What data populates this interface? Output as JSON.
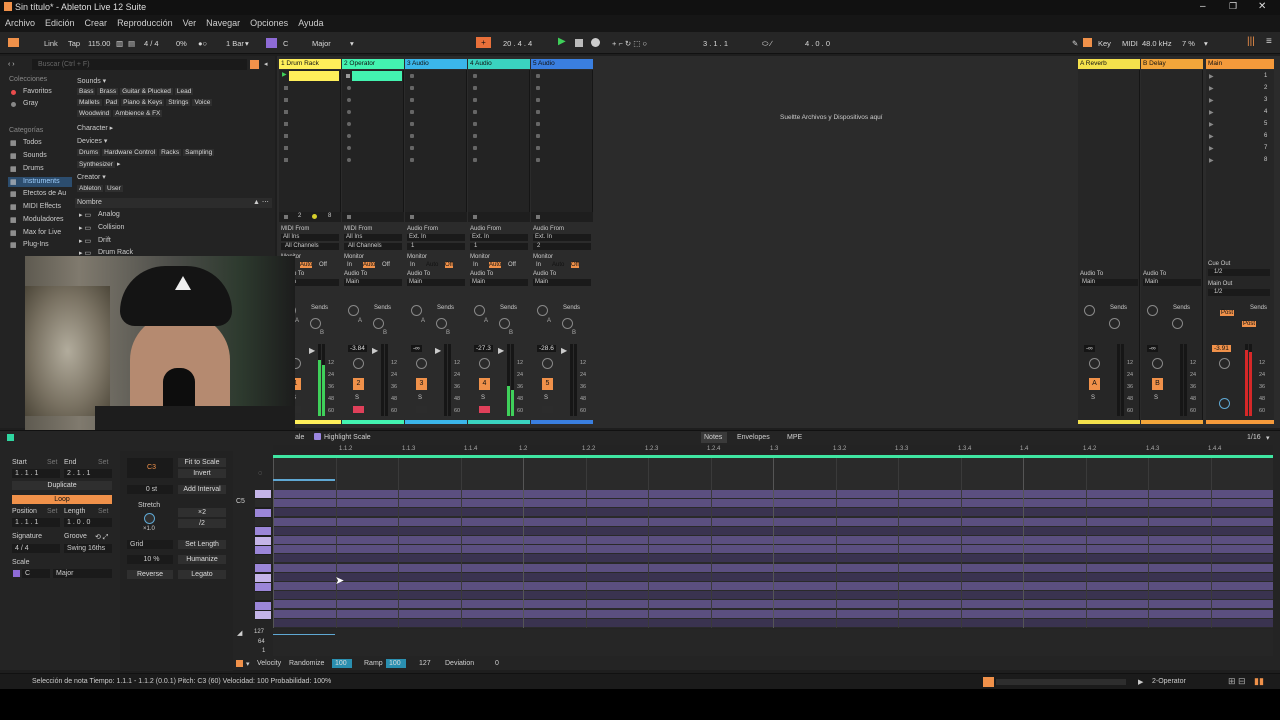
{
  "window": {
    "title": "Sin título* - Ableton Live 12 Suite"
  },
  "menu": [
    "Archivo",
    "Edición",
    "Crear",
    "Reproducción",
    "Ver",
    "Navegar",
    "Opciones",
    "Ayuda"
  ],
  "control_bar": {
    "link": "Link",
    "tap": "Tap",
    "tempo": "115.00",
    "signature": "4 / 4",
    "swing": "0%",
    "quantize": "1 Bar",
    "key": "C",
    "scale": "Major",
    "position": "20 .  4 .  4",
    "loop_start": "3 .  1 .  1",
    "loop_length": "4 .  0 .  0",
    "key_label": "Key",
    "midi_label": "MIDI",
    "sample_rate": "48.0 kHz",
    "cpu": "7 %"
  },
  "browser": {
    "search_placeholder": "Buscar (Ctrl + F)",
    "collections_header": "Colecciones",
    "collections": [
      "Favoritos",
      "Gray"
    ],
    "categories_header": "Categorías",
    "categories": [
      "Todos",
      "Sounds",
      "Drums",
      "Instruments",
      "Efectos de Au",
      "MIDI Effects",
      "Moduladores",
      "Max for Live",
      "Plug-Ins"
    ],
    "sounds_label": "Sounds ▾",
    "sounds_tags_1": [
      "Bass",
      "Brass",
      "Guitar & Plucked",
      "Lead"
    ],
    "sounds_tags_2": [
      "Mallets",
      "Pad",
      "Piano & Keys",
      "Strings",
      "Voice"
    ],
    "sounds_tags_3": [
      "Woodwind",
      "Ambience & FX"
    ],
    "character_label": "Character ▸",
    "devices_label": "Devices ▾",
    "devices_tags": [
      "Drums",
      "Hardware Control",
      "Racks",
      "Sampling"
    ],
    "synth_tag": "Synthesizer",
    "creator_label": "Creator ▾",
    "creator_tags": [
      "Ableton",
      "User"
    ],
    "name_header": "Nombre",
    "items": [
      "Analog",
      "Collision",
      "Drift",
      "Drum Rack"
    ]
  },
  "tracks": [
    {
      "name": "1 Drum Rack",
      "color": "#ffef5a",
      "input": "MIDI From",
      "src": "All Ins",
      "chan": "All Channels",
      "num": "1",
      "vol": "-7"
    },
    {
      "name": "2 Operator",
      "color": "#43f3b0",
      "input": "MIDI From",
      "src": "All Ins",
      "chan": "All Channels",
      "num": "2",
      "vol": "-3.84"
    },
    {
      "name": "3 Audio",
      "color": "#3bb6ea",
      "input": "Audio From",
      "src": "Ext. In",
      "chan": "1",
      "num": "3",
      "vol": "-∞"
    },
    {
      "name": "4 Audio",
      "color": "#3ad3c0",
      "input": "Audio From",
      "src": "Ext. In",
      "chan": "1",
      "num": "4",
      "vol": "-27.3"
    },
    {
      "name": "5 Audio",
      "color": "#3a7fe0",
      "input": "Audio From",
      "src": "Ext. In",
      "chan": "2",
      "num": "5",
      "vol": "-28.6"
    }
  ],
  "returns": [
    {
      "name": "A Reverb",
      "color": "#f4e14c",
      "letter": "A",
      "vol": "-∞"
    },
    {
      "name": "B Delay",
      "color": "#f3a63a",
      "letter": "B",
      "vol": "-∞"
    }
  ],
  "main": {
    "name": "Main",
    "color": "#f59a3b",
    "vol": "-3.91",
    "scenes": [
      "1",
      "2",
      "3",
      "4",
      "5",
      "6",
      "7",
      "8"
    ],
    "cue_out": "Cue Out",
    "cue_val": "1/2",
    "main_out": "Main Out",
    "main_val": "1/2",
    "post": "Post"
  },
  "session_labels": {
    "drop": "Sueltte Archivos y Dispositivos aquí",
    "monitor": "Monitor",
    "in": "In",
    "auto": "Auto",
    "off": "Off",
    "audio_to": "Audio To",
    "main": "Main",
    "sends": "Sends",
    "s": "S",
    "a": "A",
    "b": "B",
    "meter_ticks": [
      "12",
      "24",
      "36",
      "48",
      "60"
    ],
    "track_status": [
      "2",
      "8"
    ]
  },
  "clip": {
    "highlight": "Highlight Scale",
    "tabs": [
      "Notes",
      "Envelopes",
      "MPE"
    ],
    "grid_value": "1/16",
    "start": "Start",
    "set": "Set",
    "end": "End",
    "start_val": "1 .  1 .  1",
    "end_val": "2 .  1 .  1",
    "duplicate": "Duplicate",
    "loop": "Loop",
    "position": "Position",
    "length": "Length",
    "pos_val": "1 .  1 .  1",
    "len_val": "1 .  0 .  0",
    "signature": "Signature",
    "groove": "Groove",
    "sig_num": "4",
    "sig_den": "4",
    "swing": "Swing 16ths",
    "scale": "Scale",
    "scale_key": "C",
    "scale_name": "Major",
    "note": "C3",
    "fit": "Fit to Scale",
    "invert": "Invert",
    "interval": "0 st",
    "add_interval": "Add Interval",
    "stretch": "Stretch",
    "stretch_val": "×1.0",
    "x2": "×2",
    "div2": "/2",
    "grid": "Grid",
    "set_length": "Set Length",
    "humanize_val": "10 %",
    "humanize": "Humanize",
    "reverse": "Reverse",
    "legato": "Legato",
    "ruler": [
      "1.1.2",
      "1.1.3",
      "1.1.4",
      "1.2",
      "1.2.2",
      "1.2.3",
      "1.2.4",
      "1.3",
      "1.3.2",
      "1.3.3",
      "1.3.4",
      "1.4",
      "1.4.2",
      "1.4.3",
      "1.4.4"
    ],
    "c5": "C5",
    "vel_ticks": [
      "127",
      "64",
      "1"
    ],
    "velocity": "Velocity",
    "randomize": "Randomize",
    "rand_val": "100",
    "ramp": "Ramp",
    "ramp_val": "100",
    "ramp_end": "127",
    "deviation": "Deviation",
    "dev_val": "0"
  },
  "status": {
    "text": "Selección de nota  Tiempo: 1.1.1 - 1.1.2 (0.0.1)  Pitch: C3 (60)  Velocidad: 100  Probabilidad: 100%",
    "track": "2-Operator"
  }
}
